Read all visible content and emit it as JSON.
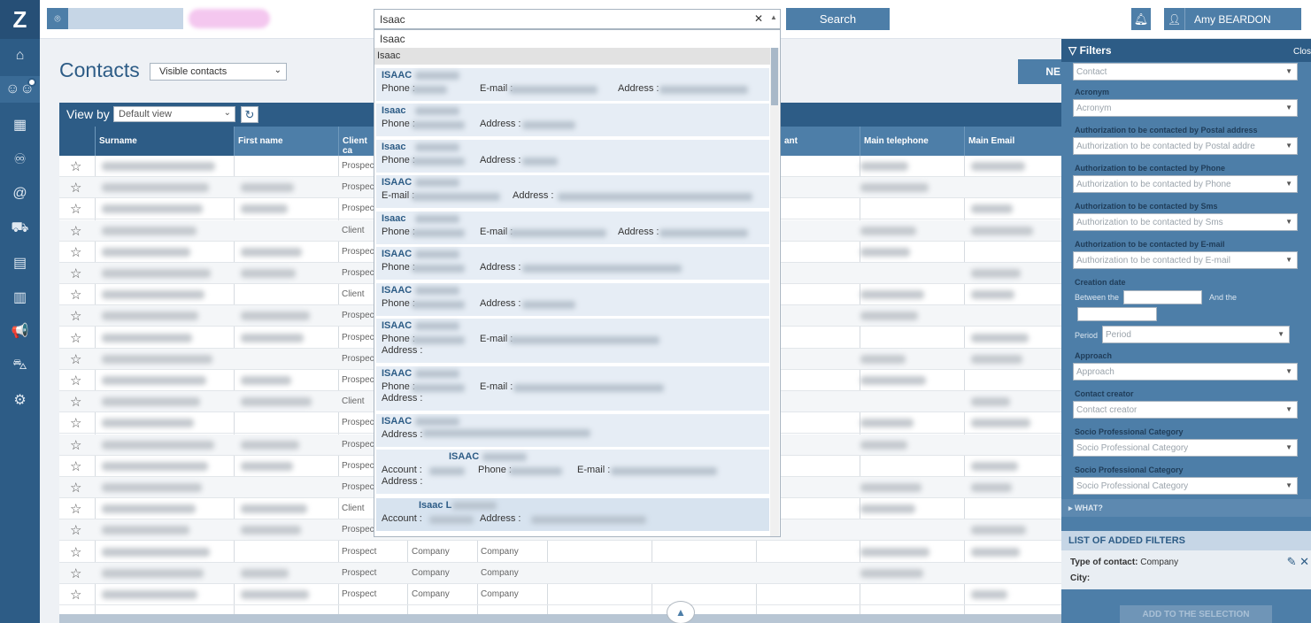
{
  "topbar": {
    "search_value": "Isaac",
    "search_clear": "✕",
    "search_button": "Search",
    "user_name": "Amy BEARDON"
  },
  "page": {
    "title": "Contacts",
    "visible_select": "Visible contacts",
    "new_button": "NE"
  },
  "viewbar": {
    "label": "View by",
    "select_value": "Default view"
  },
  "table": {
    "headers": [
      "Surname",
      "First name",
      "Client ca",
      "ant",
      "Main telephone",
      "Main Email"
    ],
    "rows": [
      [
        "Prospect",
        "",
        ""
      ],
      [
        "Prospect",
        "",
        ""
      ],
      [
        "Prospect",
        "",
        ""
      ],
      [
        "Client",
        "",
        ""
      ],
      [
        "Prospect",
        "",
        ""
      ],
      [
        "Prospect",
        "",
        ""
      ],
      [
        "Client",
        "",
        ""
      ],
      [
        "Prospect",
        "",
        ""
      ],
      [
        "Prospect",
        "",
        ""
      ],
      [
        "Prospect",
        "",
        ""
      ],
      [
        "Prospect",
        "",
        ""
      ],
      [
        "Client",
        "",
        ""
      ],
      [
        "Prospect",
        "",
        ""
      ],
      [
        "Prospect",
        "",
        ""
      ],
      [
        "Prospect",
        "",
        ""
      ],
      [
        "Prospect",
        "",
        ""
      ],
      [
        "Client",
        "",
        ""
      ],
      [
        "Prospect",
        "",
        ""
      ],
      [
        "Prospect",
        "Company",
        "Company"
      ],
      [
        "Prospect",
        "Company",
        "Company"
      ],
      [
        "Prospect",
        "Company",
        "Company"
      ]
    ]
  },
  "dropdown": {
    "typed": "Isaac",
    "highlighted": "Isaac",
    "results": [
      {
        "name": "ISAAC",
        "f1": "Phone :",
        "f2": "E-mail :",
        "f3": "Address :"
      },
      {
        "name": "Isaac",
        "f1": "Phone :",
        "f2": "Address :"
      },
      {
        "name": "Isaac",
        "f1": "Phone :",
        "f2": "Address :"
      },
      {
        "name": "ISAAC",
        "f1": "E-mail :",
        "f2": "Address :"
      },
      {
        "name": "Isaac",
        "f1": "Phone :",
        "f2": "E-mail :",
        "f3": "Address :"
      },
      {
        "name": "ISAAC",
        "f1": "Phone :",
        "f2": "Address :"
      },
      {
        "name": "ISAAC",
        "f1": "Phone :",
        "f2": "Address :"
      },
      {
        "name": "ISAAC",
        "f1": "Phone :",
        "f2": "E-mail :",
        "f3": "Address :"
      },
      {
        "name": "ISAAC",
        "f1": "Phone :",
        "f2": "E-mail :",
        "f3": "Address :"
      },
      {
        "name": "ISAAC",
        "f1": "Address :"
      },
      {
        "name": "ISAAC",
        "f1": "Account :",
        "f2": "Phone :",
        "f3": "E-mail :",
        "f4": "Address :"
      },
      {
        "name": "Isaac L",
        "f1": "Account :",
        "f2": "Address :"
      }
    ]
  },
  "filters": {
    "title": "Filters",
    "close": "Clos",
    "type_value": "Contact",
    "acronym_label": "Acronym",
    "acronym_value": "Acronym",
    "postal_label": "Authorization to be contacted by Postal address",
    "postal_value": "Authorization to be contacted by Postal addre",
    "phone_label": "Authorization to be contacted by Phone",
    "phone_value": "Authorization to be contacted by Phone",
    "sms_label": "Authorization to be contacted by Sms",
    "sms_value": "Authorization to be contacted by Sms",
    "email_label": "Authorization to be contacted by E-mail",
    "email_value": "Authorization to be contacted by E-mail",
    "creation_label": "Creation date",
    "between": "Between the",
    "and_the": "And the",
    "period_label": "Period",
    "period_value": "Period",
    "approach_label": "Approach",
    "approach_value": "Approach",
    "creator_label": "Contact creator",
    "creator_value": "Contact creator",
    "socio1_label": "Socio Professional Category",
    "socio1_value": "Socio Professional Category",
    "socio2_label": "Socio Professional Category",
    "socio2_value": "Socio Professional Category",
    "what": "▸ WHAT?",
    "added_title": "LIST OF ADDED FILTERS",
    "added_type_label": "Type of contact:",
    "added_type_value": "Company",
    "added_city_label": "City:",
    "add_button": "ADD TO THE SELECTION"
  },
  "icons": [
    "logo-z-icon",
    "home-icon",
    "contacts-icon",
    "calendar-icon",
    "handshake-icon",
    "at-icon",
    "cars-icon",
    "table-icon",
    "chart-icon",
    "megaphone-icon",
    "car-icon",
    "settings-icon"
  ]
}
